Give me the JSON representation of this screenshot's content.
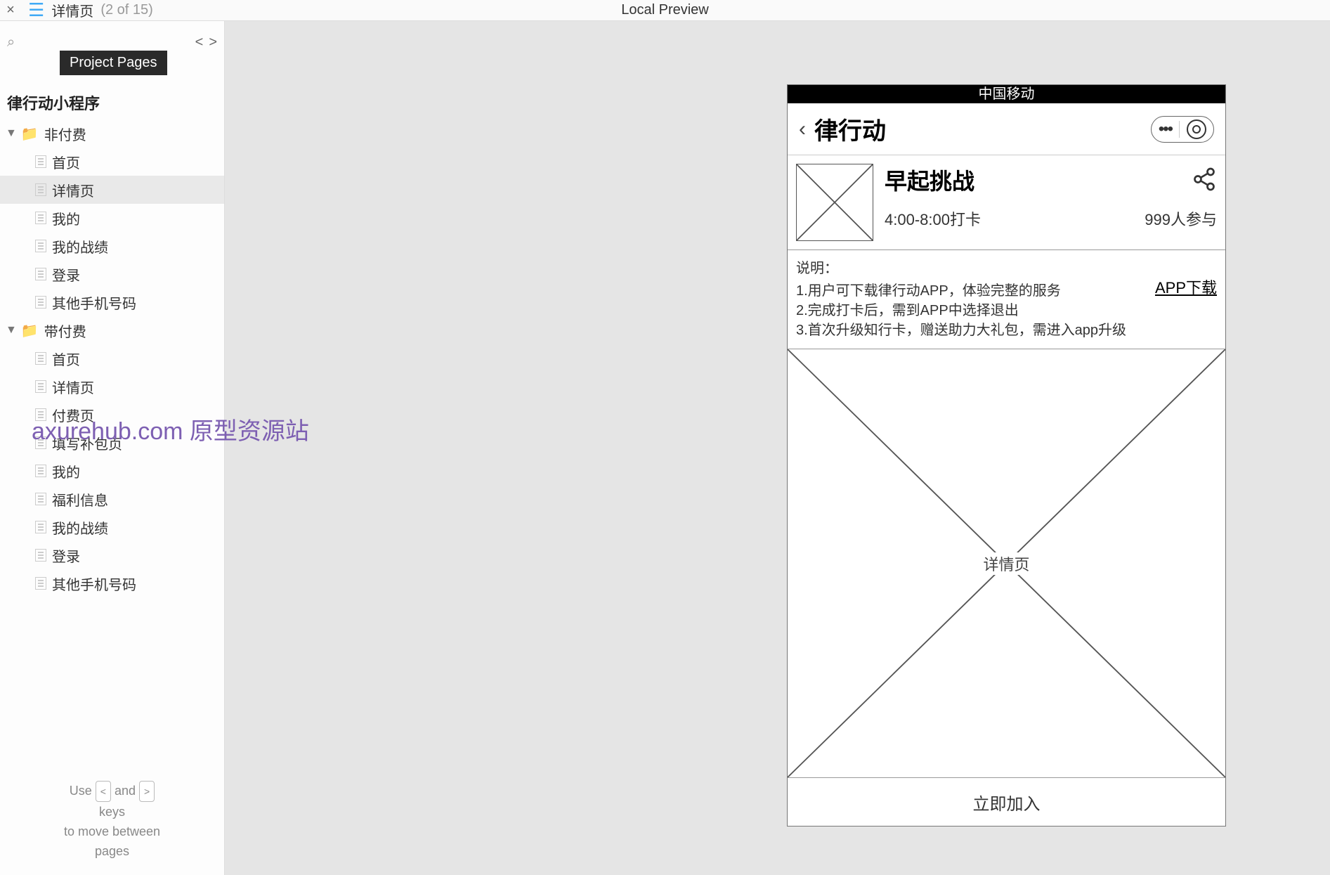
{
  "topbar": {
    "page_title": "详情页",
    "page_count": "(2 of 15)",
    "center_title": "Local Preview"
  },
  "sidebar": {
    "badge": "Project Pages",
    "project_name": "律行动小程序",
    "folder1": "非付费",
    "folder1_items": [
      "首页",
      "详情页",
      "我的",
      "我的战绩",
      "登录",
      "其他手机号码"
    ],
    "folder2": "带付费",
    "folder2_items": [
      "首页",
      "详情页",
      "付费页",
      "填写补包页",
      "我的",
      "福利信息",
      "我的战绩",
      "登录",
      "其他手机号码"
    ],
    "hint_use": "Use",
    "hint_and": "and",
    "hint_keys": "keys",
    "hint_line2": "to move between",
    "hint_line3": "pages"
  },
  "phone": {
    "carrier": "中国移动",
    "app_title": "律行动",
    "card": {
      "title": "早起挑战",
      "subtitle": "4:00-8:00打卡",
      "count": "999人参与"
    },
    "desc": {
      "label": "说明：",
      "line1": "1.用户可下载律行动APP，体验完整的服务",
      "line2": "2.完成打卡后，需到APP中选择退出",
      "line3": "3.首次升级知行卡，赠送助力大礼包，需进入app升级",
      "download": "APP下载"
    },
    "big_image_label": "详情页",
    "cta": "立即加入"
  },
  "watermark": "axurehub.com 原型资源站"
}
